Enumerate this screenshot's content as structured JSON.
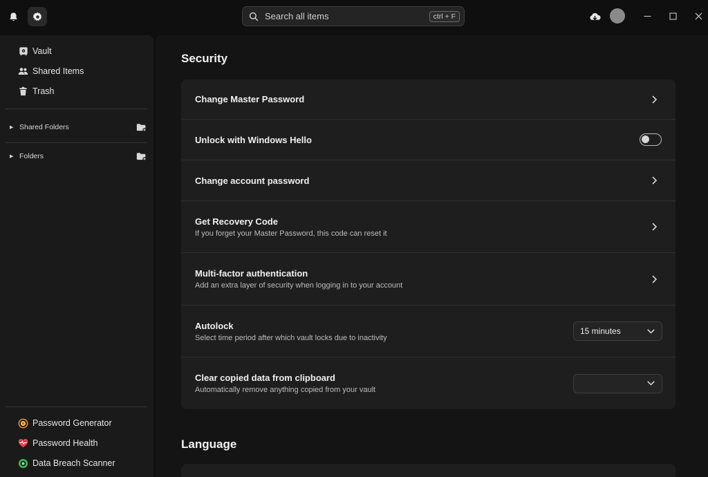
{
  "topbar": {
    "search_placeholder": "Search all items",
    "search_shortcut": "ctrl + F"
  },
  "sidebar": {
    "nav": [
      {
        "label": "Vault",
        "icon": "vault-icon"
      },
      {
        "label": "Shared Items",
        "icon": "people-icon"
      },
      {
        "label": "Trash",
        "icon": "trash-icon"
      }
    ],
    "folders": [
      {
        "label": "Shared Folders"
      },
      {
        "label": "Folders"
      }
    ],
    "tools": [
      {
        "label": "Password Generator",
        "icon": "password-generator-icon"
      },
      {
        "label": "Password Health",
        "icon": "password-health-icon"
      },
      {
        "label": "Data Breach Scanner",
        "icon": "data-breach-scanner-icon"
      }
    ]
  },
  "main": {
    "security_title": "Security",
    "language_title": "Language",
    "rows": [
      {
        "title": "Change Master Password",
        "subtitle": ""
      },
      {
        "title": "Unlock with Windows Hello",
        "subtitle": "",
        "toggle_on": false
      },
      {
        "title": "Change account password",
        "subtitle": ""
      },
      {
        "title": "Get Recovery Code",
        "subtitle": "If you forget your Master Password, this code can reset it"
      },
      {
        "title": "Multi-factor authentication",
        "subtitle": "Add an extra layer of security when logging in to your account"
      },
      {
        "title": "Autolock",
        "subtitle": "Select time period after which vault locks due to inactivity",
        "select_value": "15 minutes"
      },
      {
        "title": "Clear copied data from clipboard",
        "subtitle": "Automatically remove anything copied from your vault",
        "select_value": ""
      }
    ]
  },
  "colors": {
    "background": "#0f0f0f",
    "sidebar": "#1a1a1a",
    "card": "#1e1e1e",
    "text": "#f0f0f0",
    "generator_accent": "#e8832a",
    "health_accent": "#e0404f",
    "breach_accent": "#3dbb4f"
  }
}
